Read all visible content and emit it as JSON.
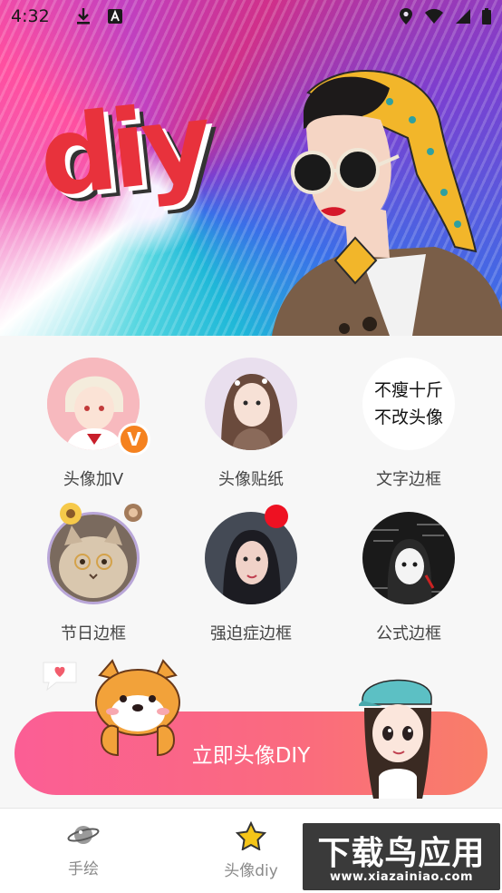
{
  "status_bar": {
    "time": "4:32"
  },
  "banner": {
    "logo_text": "diy"
  },
  "grid": {
    "items": [
      {
        "label": "头像加V",
        "badge": "V"
      },
      {
        "label": "头像贴纸"
      },
      {
        "label": "文字边框",
        "sticker_line1": "不瘦十斤",
        "sticker_line2": "不改头像"
      },
      {
        "label": "节日边框"
      },
      {
        "label": "强迫症边框"
      },
      {
        "label": "公式边框"
      }
    ]
  },
  "cta": {
    "label": "立即头像DIY"
  },
  "bottom_nav": {
    "tabs": [
      {
        "label": "手绘",
        "icon": "planet-icon"
      },
      {
        "label": "头像diy",
        "icon": "star-icon",
        "active": true
      }
    ]
  },
  "watermark": {
    "title": "下载鸟应用",
    "url": "www.xiazainiao.com"
  },
  "colors": {
    "cta_start": "#fb5e95",
    "cta_end": "#f97e68",
    "badge": "#f5821f",
    "dot_red": "#ee1122"
  }
}
